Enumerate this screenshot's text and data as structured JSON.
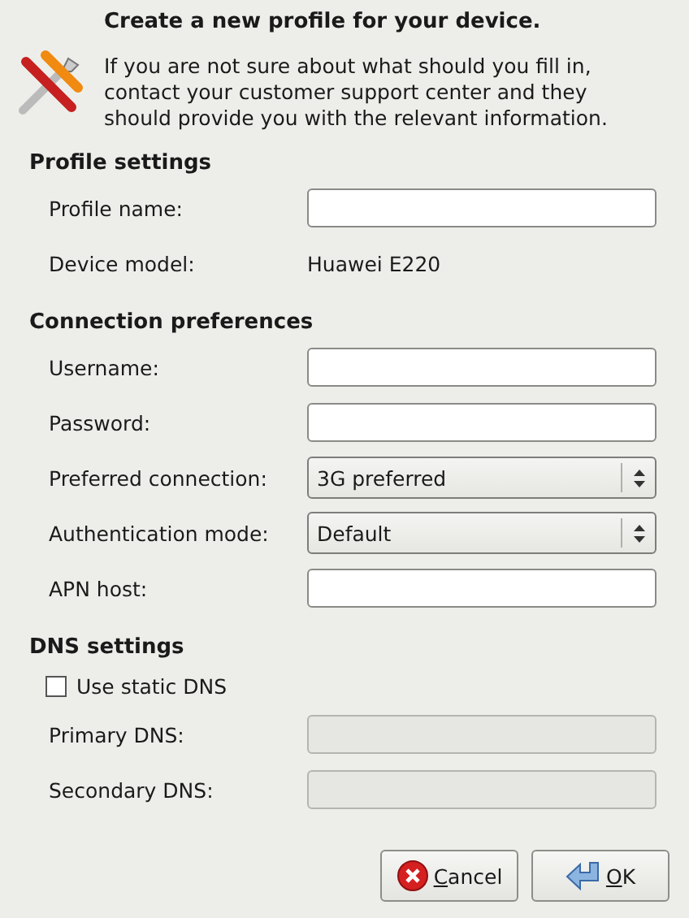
{
  "header": {
    "title": "Create a new profile for your device.",
    "message": "If you are not sure about what should you fill in, contact your customer support center and they should provide you with the relevant information."
  },
  "sections": [
    {
      "title": "Profile settings",
      "rows": [
        {
          "kind": "entry",
          "label": "Profile name:",
          "disabled": false
        },
        {
          "kind": "text",
          "label": "Device model:",
          "value": "Huawei E220"
        }
      ]
    },
    {
      "title": "Connection preferences",
      "rows": [
        {
          "kind": "entry",
          "label": "Username:",
          "disabled": false
        },
        {
          "kind": "entry",
          "label": "Password:",
          "disabled": false
        },
        {
          "kind": "combo",
          "label": "Preferred connection:",
          "value": "3G preferred"
        },
        {
          "kind": "combo",
          "label": "Authentication mode:",
          "value": "Default"
        },
        {
          "kind": "entry",
          "label": "APN host:",
          "disabled": false
        }
      ]
    },
    {
      "title": "DNS settings",
      "rows": [
        {
          "kind": "checkbox",
          "label": "Use static DNS",
          "checked": false
        },
        {
          "kind": "entry",
          "label": "Primary DNS:",
          "disabled": true
        },
        {
          "kind": "entry",
          "label": "Secondary DNS:",
          "disabled": true
        }
      ]
    }
  ],
  "buttons": [
    {
      "kind": "cancel",
      "label": "Cancel"
    },
    {
      "kind": "ok",
      "label": "OK"
    }
  ]
}
